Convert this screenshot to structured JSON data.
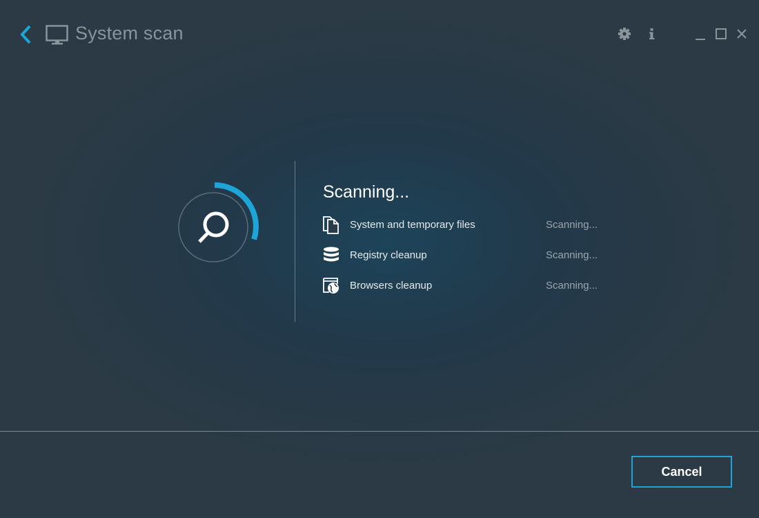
{
  "window": {
    "title": "System scan",
    "accent_color": "#1ea5d8"
  },
  "titlebar": {
    "back_icon": "chevron-left-icon",
    "title_icon": "monitor-icon",
    "actions": [
      "gear-icon",
      "info-icon",
      "minimize-icon",
      "maximize-icon",
      "close-icon"
    ]
  },
  "scan": {
    "heading": "Scanning...",
    "progress_fraction": 0.3,
    "items": [
      {
        "icon": "files-icon",
        "label": "System and temporary files",
        "status": "Scanning..."
      },
      {
        "icon": "database-icon",
        "label": "Registry cleanup",
        "status": "Scanning..."
      },
      {
        "icon": "browser-globe-icon",
        "label": "Browsers cleanup",
        "status": "Scanning..."
      }
    ]
  },
  "footer": {
    "cancel_label": "Cancel"
  }
}
